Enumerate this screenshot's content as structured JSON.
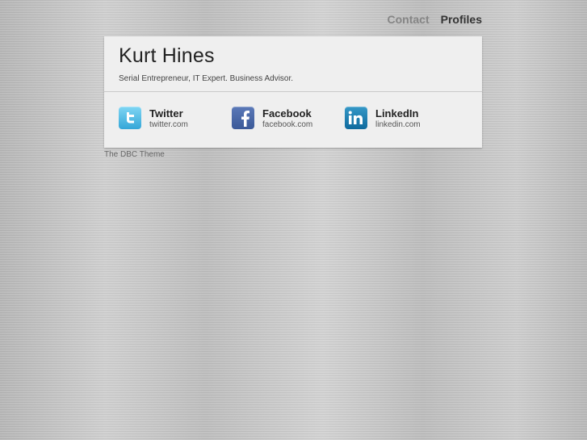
{
  "nav": {
    "contact": "Contact",
    "profiles": "Profiles"
  },
  "header": {
    "name": "Kurt Hines",
    "tagline": "Serial Entrepreneur, IT Expert. Business Advisor."
  },
  "profiles": [
    {
      "title": "Twitter",
      "url": "twitter.com",
      "icon": "twitter-icon",
      "color": "#34a6d8"
    },
    {
      "title": "Facebook",
      "url": "facebook.com",
      "icon": "facebook-icon",
      "color": "#3b5998"
    },
    {
      "title": "LinkedIn",
      "url": "linkedin.com",
      "icon": "linkedin-icon",
      "color": "#0f6a9d"
    }
  ],
  "footer": {
    "text": "The DBC Theme"
  }
}
